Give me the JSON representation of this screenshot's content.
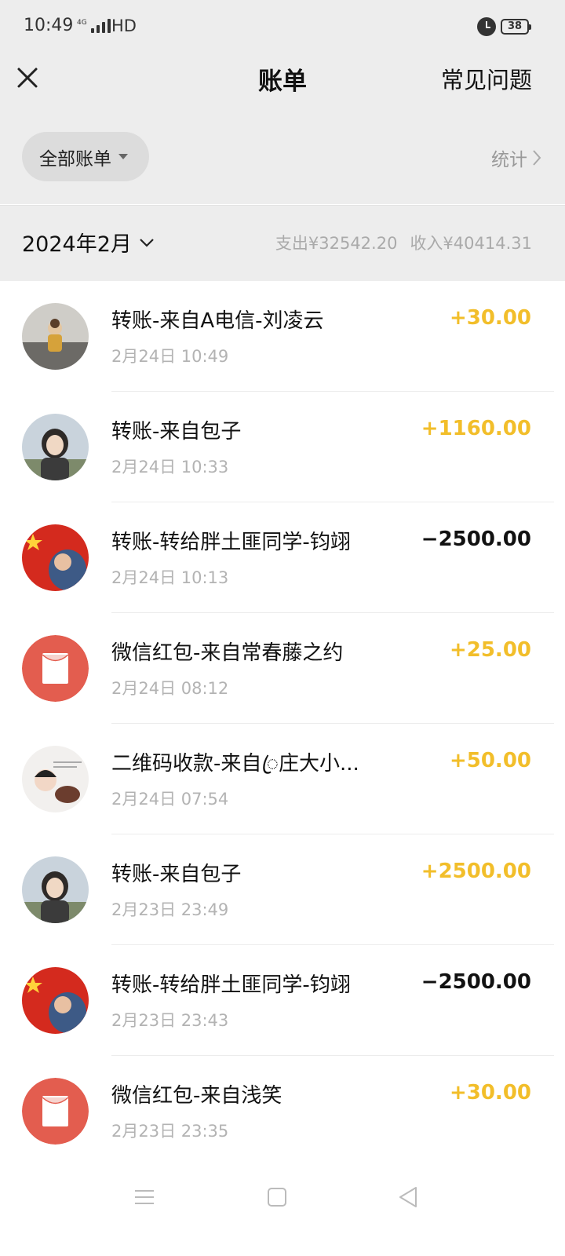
{
  "status": {
    "time": "10:49",
    "network": "4G",
    "hd": "HD",
    "battery": "38"
  },
  "header": {
    "title": "账单",
    "faq_label": "常见问题"
  },
  "filter": {
    "label": "全部账单",
    "stats_label": "统计"
  },
  "month": {
    "label": "2024年2月",
    "expense": "支出¥32542.20",
    "income": "收入¥40414.31"
  },
  "transactions": [
    {
      "title": "转账-来自A电信-刘凌云",
      "time": "2月24日 10:49",
      "amount": "+30.00",
      "type": "income",
      "avatar": "photo-child"
    },
    {
      "title": "转账-来自包子",
      "time": "2月24日 10:33",
      "amount": "+1160.00",
      "type": "income",
      "avatar": "photo-woman"
    },
    {
      "title": "转账-转给胖土匪同学-钧翊",
      "time": "2月24日 10:13",
      "amount": "−2500.00",
      "type": "expense",
      "avatar": "photo-flag"
    },
    {
      "title": "微信红包-来自常春藤之约",
      "time": "2月24日 08:12",
      "amount": "+25.00",
      "type": "income",
      "avatar": "red-packet"
    },
    {
      "title": "二维码收款-来自ꦿ庄大小...",
      "time": "2月24日 07:54",
      "amount": "+50.00",
      "type": "income",
      "avatar": "photo-cartoon"
    },
    {
      "title": "转账-来自包子",
      "time": "2月23日 23:49",
      "amount": "+2500.00",
      "type": "income",
      "avatar": "photo-woman"
    },
    {
      "title": "转账-转给胖土匪同学-钧翊",
      "time": "2月23日 23:43",
      "amount": "−2500.00",
      "type": "expense",
      "avatar": "photo-flag"
    },
    {
      "title": "微信红包-来自浅笑",
      "time": "2月23日 23:35",
      "amount": "+30.00",
      "type": "income",
      "avatar": "red-packet"
    }
  ],
  "colors": {
    "income": "#f2be2a",
    "expense": "#111111",
    "red_packet": "#e35d4f",
    "background": "#ededed"
  }
}
